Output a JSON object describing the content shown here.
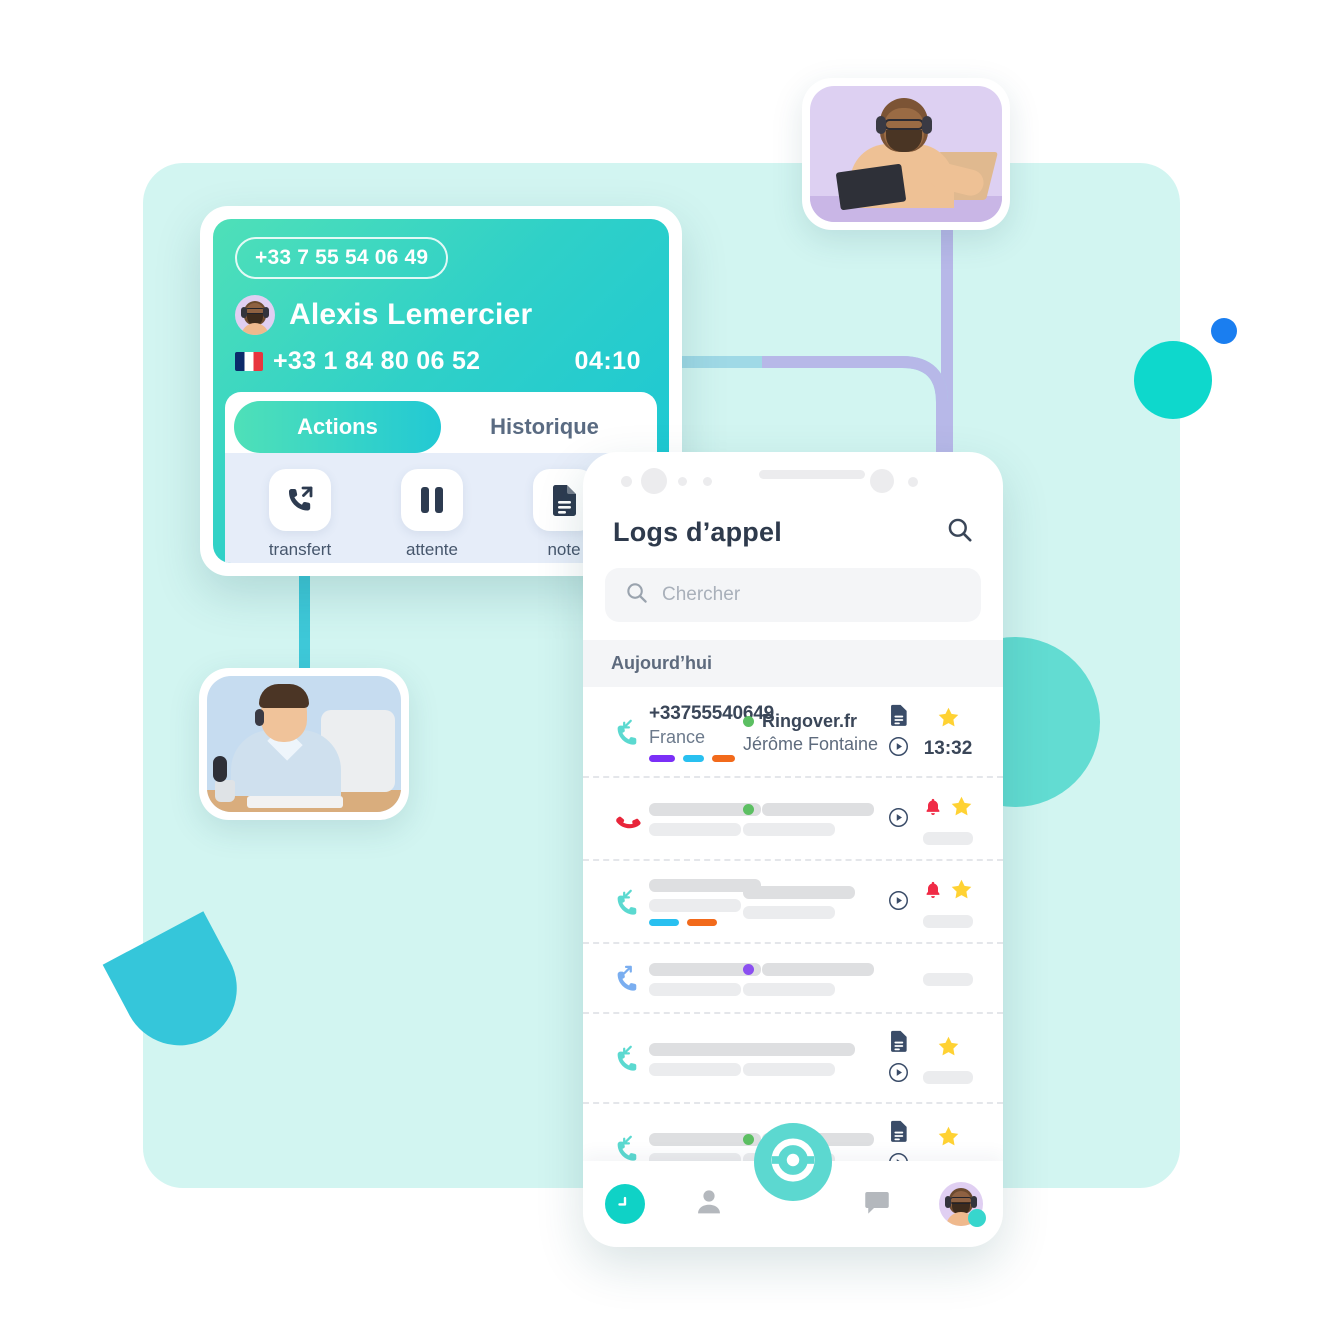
{
  "call_card": {
    "caller_phone_pill": "+33 7 55 54 06 49",
    "caller_name": "Alexis Lemercier",
    "line_number": "+33 1 84 80 06 52",
    "line_flag": "fr-flag-icon",
    "call_timer": "04:10",
    "avatar_icon": "agent-avatar",
    "tabs": [
      {
        "label": "Actions",
        "active": true
      },
      {
        "label": "Historique",
        "active": false
      }
    ],
    "actions": [
      {
        "label": "transfert",
        "icon": "call-transfer-icon"
      },
      {
        "label": "attente",
        "icon": "pause-icon"
      },
      {
        "label": "note",
        "icon": "note-document-icon"
      }
    ],
    "colors": {
      "gradient_start": "#4fe0b8",
      "gradient_end": "#19c6d6",
      "panel": "#e6edf9"
    }
  },
  "phone": {
    "title": "Logs d’appel",
    "header_search_icon": "search-icon",
    "search": {
      "icon": "search-icon",
      "placeholder": "Chercher",
      "value": ""
    },
    "section_header": "Aujourd’hui",
    "rows": [
      {
        "direction": "incoming",
        "direction_icon": "phone-incoming-icon",
        "direction_color": "#5bd9d0",
        "number": "+33755540649",
        "country": "France",
        "tags": [
          "#7b2ff7",
          "#29c0f0",
          "#f26a1b"
        ],
        "status_dot": "#5cbf62",
        "org": "Ringover.fr",
        "person": "Jérôme Fontaine",
        "has_note": true,
        "has_play": true,
        "has_bell": false,
        "has_star": true,
        "time": "13:32",
        "skeleton": false
      },
      {
        "direction": "missed",
        "direction_icon": "phone-missed-icon",
        "direction_color": "#e8253a",
        "status_dot": "#5cbf62",
        "tags": [],
        "has_note": false,
        "has_play": true,
        "has_bell": true,
        "has_star": true,
        "skeleton": true
      },
      {
        "direction": "incoming",
        "direction_icon": "phone-incoming-icon",
        "direction_color": "#5bd9d0",
        "status_dot": "",
        "tags": [
          "#29c0f0",
          "#f26a1b"
        ],
        "has_note": false,
        "has_play": true,
        "has_bell": true,
        "has_star": true,
        "skeleton": true
      },
      {
        "direction": "outgoing",
        "direction_icon": "phone-outgoing-icon",
        "direction_color": "#7aaef0",
        "status_dot": "#8b4ff0",
        "tags": [],
        "has_note": false,
        "has_play": false,
        "has_bell": false,
        "has_star": false,
        "skeleton": true
      },
      {
        "direction": "incoming",
        "direction_icon": "phone-incoming-icon",
        "direction_color": "#5bd9d0",
        "status_dot": "",
        "tags": [],
        "has_note": true,
        "has_play": true,
        "has_bell": false,
        "has_star": true,
        "skeleton": true
      },
      {
        "direction": "incoming",
        "direction_icon": "phone-incoming-icon",
        "direction_color": "#5bd9d0",
        "status_dot": "#5cbf62",
        "tags": [],
        "has_note": true,
        "has_play": true,
        "has_bell": false,
        "has_star": true,
        "skeleton": true
      }
    ],
    "bottom_nav": {
      "items": [
        {
          "name": "history-tab",
          "icon": "clock-icon",
          "active": true
        },
        {
          "name": "contacts-tab",
          "icon": "person-icon",
          "active": false
        },
        {
          "name": "dial-fab",
          "icon": "ringover-logo-icon",
          "active": false
        },
        {
          "name": "messages-tab",
          "icon": "chat-bubble-icon",
          "active": false
        },
        {
          "name": "profile-tab",
          "icon": "avatar-icon",
          "active": false
        }
      ],
      "fab_color": "#5cd8d0",
      "active_color": "#0fd2c6"
    }
  },
  "decor": {
    "panel_color": "#d2f5f1",
    "teal_circle": "#0ed8cc",
    "blue_dot": "#1a7ef0",
    "half_moon": "#35c6da",
    "big_circle": "#62dcd2",
    "connector_teal": "#3ec8d8",
    "connector_purple": "#b7b8e8",
    "photo_top": {
      "name": "agent-photo-headset-laptop",
      "bg": "#ddd0f2"
    },
    "photo_bottom": {
      "name": "agent-photo-desktop",
      "bg": "#c6dcf0"
    }
  }
}
